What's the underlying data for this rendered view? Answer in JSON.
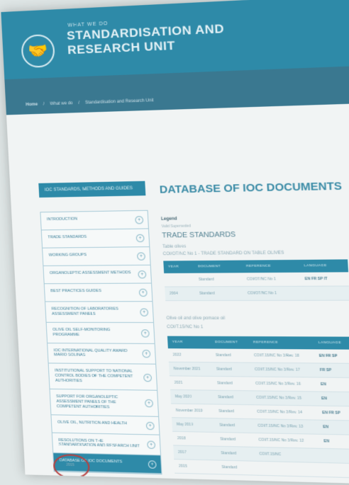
{
  "header": {
    "pre_title": "WHAT WE DO",
    "title_line1": "STANDARDISATION AND",
    "title_line2": "RESEARCH UNIT",
    "logo_icon": "handshake-icon"
  },
  "breadcrumb": {
    "home": "Home",
    "items": [
      "What we do",
      "Standardisation and Research Unit"
    ]
  },
  "sidebar": {
    "header": "IOC STANDARDS, METHODS AND GUIDES",
    "items": [
      {
        "label": "INTRODUCTION"
      },
      {
        "label": "TRADE STANDARDS"
      },
      {
        "label": "WORKING GROUPS"
      },
      {
        "label": "ORGANOLEPTIC ASSESSMENT METHODS"
      },
      {
        "label": "BEST PRACTICES GUIDES"
      },
      {
        "label": "RECOGNITION OF LABORATORIES ASSESSMENT PANELS"
      },
      {
        "label": "OLIVE OIL SELF-MONITORING PROGRAMME"
      },
      {
        "label": "IOC INTERNATIONAL QUALITY AWARD MARIO SOLINAS"
      },
      {
        "label": "INSTITUTIONAL SUPPORT TO NATIONAL CONTROL BODIES OF THE COMPETENT AUTHORITIES"
      },
      {
        "label": "SUPPORT FOR ORGANOLEPTIC ASSESSMENT PANELS OF THE COMPETENT AUTHORITIES"
      },
      {
        "label": "OLIVE OIL, NUTRITION AND HEALTH"
      },
      {
        "label": "RESOLUTIONS ON THE STANDARDISATION AND RESEARCH UNIT"
      },
      {
        "label": "DATABASE OF IOC DOCUMENTS",
        "active": true
      }
    ]
  },
  "main": {
    "title": "DATABASE OF IOC DOCUMENTS",
    "legend_label": "Legend",
    "legend_text": "Valid  Superseded",
    "section_title": "TRADE STANDARDS",
    "table1": {
      "subtitle1": "Table olives",
      "subtitle2": "COI/OT/NC No 1 - TRADE STANDARD ON TABLE OLIVES",
      "headers": [
        "YEAR",
        "DOCUMENT",
        "REFERENCE",
        "LANGUAGE"
      ],
      "rows": [
        [
          "",
          "Standard",
          "COI/OT/NC No 1",
          "EN FR SP IT"
        ],
        [
          "2004",
          "Standard",
          "COI/OT/NC No 1",
          ""
        ]
      ]
    },
    "table2": {
      "subtitle1": "Olive oil and olive pomace oil",
      "subtitle2": "COI/T.15/NC No 1",
      "headers": [
        "YEAR",
        "DOCUMENT",
        "REFERENCE",
        "LANGUAGE"
      ],
      "rows": [
        [
          "2022",
          "Standard",
          "COI/T.15/NC No 3/Rev. 18",
          "EN FR SP"
        ],
        [
          "November 2021",
          "Standard",
          "COI/T.15/NC No 3/Rev. 17",
          "FR SP"
        ],
        [
          "2021",
          "Standard",
          "COI/T.15/NC No 3/Rev. 16",
          "EN"
        ],
        [
          "May 2020",
          "Standard",
          "COI/T.15/NC No 3/Rev. 15",
          "EN"
        ],
        [
          "November 2019",
          "Standard",
          "COI/T.15/NC No 3/Rev. 14",
          "EN FR SP"
        ],
        [
          "May 2019",
          "Standard",
          "COI/T.15/NC No 3/Rev. 13",
          "EN"
        ],
        [
          "2018",
          "Standard",
          "COI/T.15/NC No 3/Rev. 12",
          "EN"
        ],
        [
          "2017",
          "Standard",
          "COI/T.15/NC",
          ""
        ],
        [
          "2015",
          "Standard",
          "",
          ""
        ]
      ]
    }
  },
  "annotation": {
    "circled_text": "2015",
    "circle_color": "#b8403f"
  },
  "colors": {
    "brand": "#2e8aa8",
    "header_band": "#3a7890",
    "background": "#f1f4f4"
  }
}
